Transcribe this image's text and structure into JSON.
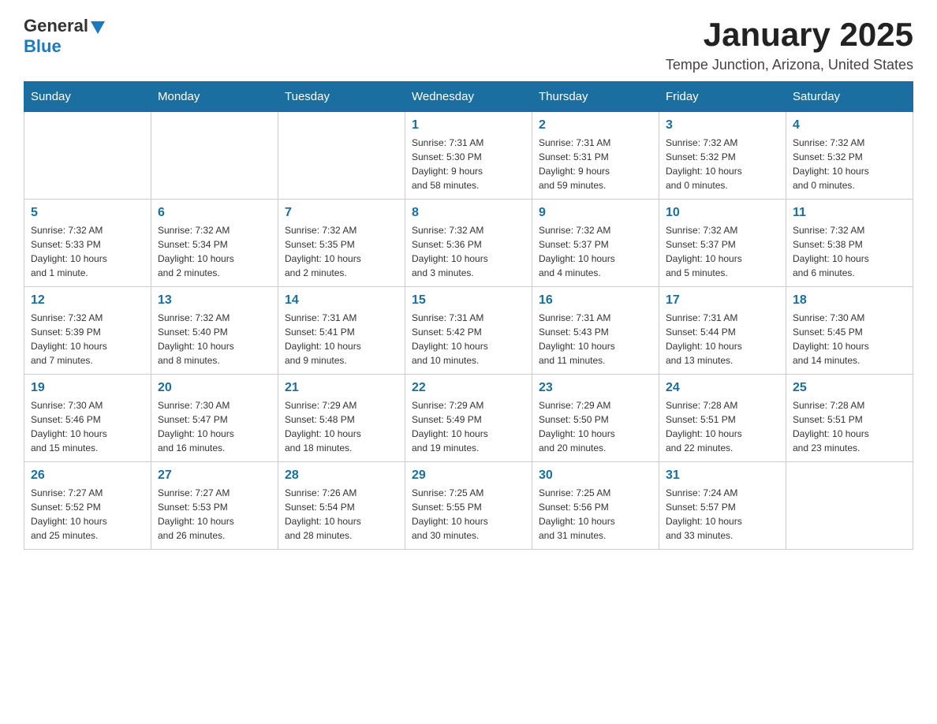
{
  "logo": {
    "general": "General",
    "blue": "Blue"
  },
  "title": "January 2025",
  "location": "Tempe Junction, Arizona, United States",
  "weekdays": [
    "Sunday",
    "Monday",
    "Tuesday",
    "Wednesday",
    "Thursday",
    "Friday",
    "Saturday"
  ],
  "weeks": [
    [
      {
        "day": "",
        "info": ""
      },
      {
        "day": "",
        "info": ""
      },
      {
        "day": "",
        "info": ""
      },
      {
        "day": "1",
        "info": "Sunrise: 7:31 AM\nSunset: 5:30 PM\nDaylight: 9 hours\nand 58 minutes."
      },
      {
        "day": "2",
        "info": "Sunrise: 7:31 AM\nSunset: 5:31 PM\nDaylight: 9 hours\nand 59 minutes."
      },
      {
        "day": "3",
        "info": "Sunrise: 7:32 AM\nSunset: 5:32 PM\nDaylight: 10 hours\nand 0 minutes."
      },
      {
        "day": "4",
        "info": "Sunrise: 7:32 AM\nSunset: 5:32 PM\nDaylight: 10 hours\nand 0 minutes."
      }
    ],
    [
      {
        "day": "5",
        "info": "Sunrise: 7:32 AM\nSunset: 5:33 PM\nDaylight: 10 hours\nand 1 minute."
      },
      {
        "day": "6",
        "info": "Sunrise: 7:32 AM\nSunset: 5:34 PM\nDaylight: 10 hours\nand 2 minutes."
      },
      {
        "day": "7",
        "info": "Sunrise: 7:32 AM\nSunset: 5:35 PM\nDaylight: 10 hours\nand 2 minutes."
      },
      {
        "day": "8",
        "info": "Sunrise: 7:32 AM\nSunset: 5:36 PM\nDaylight: 10 hours\nand 3 minutes."
      },
      {
        "day": "9",
        "info": "Sunrise: 7:32 AM\nSunset: 5:37 PM\nDaylight: 10 hours\nand 4 minutes."
      },
      {
        "day": "10",
        "info": "Sunrise: 7:32 AM\nSunset: 5:37 PM\nDaylight: 10 hours\nand 5 minutes."
      },
      {
        "day": "11",
        "info": "Sunrise: 7:32 AM\nSunset: 5:38 PM\nDaylight: 10 hours\nand 6 minutes."
      }
    ],
    [
      {
        "day": "12",
        "info": "Sunrise: 7:32 AM\nSunset: 5:39 PM\nDaylight: 10 hours\nand 7 minutes."
      },
      {
        "day": "13",
        "info": "Sunrise: 7:32 AM\nSunset: 5:40 PM\nDaylight: 10 hours\nand 8 minutes."
      },
      {
        "day": "14",
        "info": "Sunrise: 7:31 AM\nSunset: 5:41 PM\nDaylight: 10 hours\nand 9 minutes."
      },
      {
        "day": "15",
        "info": "Sunrise: 7:31 AM\nSunset: 5:42 PM\nDaylight: 10 hours\nand 10 minutes."
      },
      {
        "day": "16",
        "info": "Sunrise: 7:31 AM\nSunset: 5:43 PM\nDaylight: 10 hours\nand 11 minutes."
      },
      {
        "day": "17",
        "info": "Sunrise: 7:31 AM\nSunset: 5:44 PM\nDaylight: 10 hours\nand 13 minutes."
      },
      {
        "day": "18",
        "info": "Sunrise: 7:30 AM\nSunset: 5:45 PM\nDaylight: 10 hours\nand 14 minutes."
      }
    ],
    [
      {
        "day": "19",
        "info": "Sunrise: 7:30 AM\nSunset: 5:46 PM\nDaylight: 10 hours\nand 15 minutes."
      },
      {
        "day": "20",
        "info": "Sunrise: 7:30 AM\nSunset: 5:47 PM\nDaylight: 10 hours\nand 16 minutes."
      },
      {
        "day": "21",
        "info": "Sunrise: 7:29 AM\nSunset: 5:48 PM\nDaylight: 10 hours\nand 18 minutes."
      },
      {
        "day": "22",
        "info": "Sunrise: 7:29 AM\nSunset: 5:49 PM\nDaylight: 10 hours\nand 19 minutes."
      },
      {
        "day": "23",
        "info": "Sunrise: 7:29 AM\nSunset: 5:50 PM\nDaylight: 10 hours\nand 20 minutes."
      },
      {
        "day": "24",
        "info": "Sunrise: 7:28 AM\nSunset: 5:51 PM\nDaylight: 10 hours\nand 22 minutes."
      },
      {
        "day": "25",
        "info": "Sunrise: 7:28 AM\nSunset: 5:51 PM\nDaylight: 10 hours\nand 23 minutes."
      }
    ],
    [
      {
        "day": "26",
        "info": "Sunrise: 7:27 AM\nSunset: 5:52 PM\nDaylight: 10 hours\nand 25 minutes."
      },
      {
        "day": "27",
        "info": "Sunrise: 7:27 AM\nSunset: 5:53 PM\nDaylight: 10 hours\nand 26 minutes."
      },
      {
        "day": "28",
        "info": "Sunrise: 7:26 AM\nSunset: 5:54 PM\nDaylight: 10 hours\nand 28 minutes."
      },
      {
        "day": "29",
        "info": "Sunrise: 7:25 AM\nSunset: 5:55 PM\nDaylight: 10 hours\nand 30 minutes."
      },
      {
        "day": "30",
        "info": "Sunrise: 7:25 AM\nSunset: 5:56 PM\nDaylight: 10 hours\nand 31 minutes."
      },
      {
        "day": "31",
        "info": "Sunrise: 7:24 AM\nSunset: 5:57 PM\nDaylight: 10 hours\nand 33 minutes."
      },
      {
        "day": "",
        "info": ""
      }
    ]
  ]
}
